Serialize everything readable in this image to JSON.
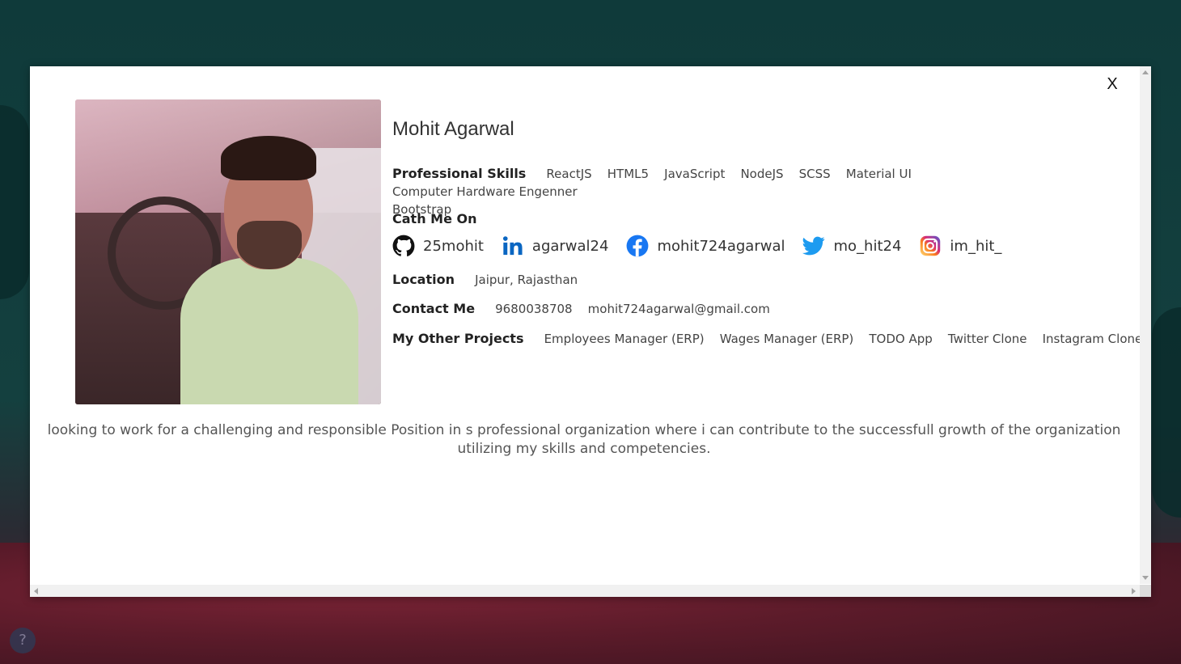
{
  "profile": {
    "name": "Mohit Agarwal",
    "photo_alt": "Profile photo"
  },
  "modal": {
    "close_label": "X"
  },
  "skills": {
    "label": "Professional Skills",
    "items": [
      "ReactJS",
      "HTML5",
      "JavaScript",
      "NodeJS",
      "SCSS",
      "Material UI",
      "Computer Hardware Engenner",
      "Bootstrap"
    ]
  },
  "social": {
    "title": "Cath Me On",
    "items": [
      {
        "icon": "github-icon",
        "handle": "25mohit",
        "color": "#111111"
      },
      {
        "icon": "linkedin-icon",
        "handle": "agarwal24",
        "color": "#0a66c2"
      },
      {
        "icon": "facebook-icon",
        "handle": "mohit724agarwal",
        "color": "#1877f2"
      },
      {
        "icon": "twitter-icon",
        "handle": "mo_hit24",
        "color": "#1d9bf0"
      },
      {
        "icon": "instagram-icon",
        "handle": "im_hit_",
        "color": "#e1306c"
      }
    ]
  },
  "location": {
    "label": "Location",
    "value": "Jaipur, Rajasthan"
  },
  "contact": {
    "label": "Contact Me",
    "phone": "9680038708",
    "email": "mohit724agarwal@gmail.com"
  },
  "projects": {
    "label": "My Other Projects",
    "items": [
      "Employees Manager (ERP)",
      "Wages Manager (ERP)",
      "TODO App",
      "Twitter Clone",
      "Instagram Clone"
    ]
  },
  "about": {
    "text": "looking to work for a challenging and responsible Position in s professional organization where i can contribute to the successfull growth of the organization utilizing my skills and competencies."
  },
  "help": {
    "label": "?"
  }
}
